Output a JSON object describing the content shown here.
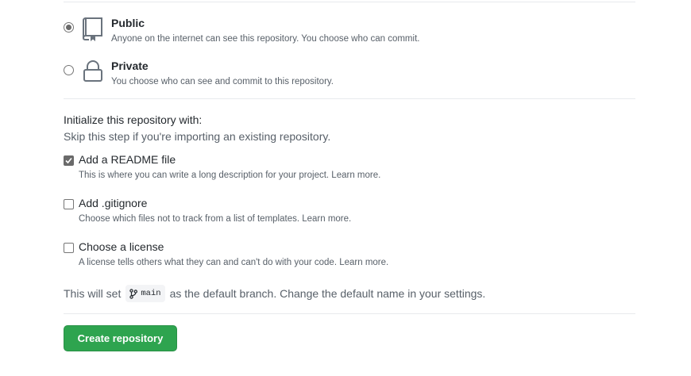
{
  "visibility": {
    "options": [
      {
        "title": "Public",
        "description": "Anyone on the internet can see this repository. You choose who can commit.",
        "icon": "repo-icon",
        "selected": true
      },
      {
        "title": "Private",
        "description": "You choose who can see and commit to this repository.",
        "icon": "lock-icon",
        "selected": false
      }
    ]
  },
  "initialize": {
    "title": "Initialize this repository with:",
    "subtitle": "Skip this step if you're importing an existing repository.",
    "options": [
      {
        "label": "Add a README file",
        "description": "This is where you can write a long description for your project. Learn more.",
        "checked": true
      },
      {
        "label": "Add .gitignore",
        "description": "Choose which files not to track from a list of templates. Learn more.",
        "checked": false
      },
      {
        "label": "Choose a license",
        "description": "A license tells others what they can and can't do with your code. Learn more.",
        "checked": false
      }
    ]
  },
  "branch": {
    "prefix": "This will set",
    "name": "main",
    "suffix": "as the default branch. Change the default name in your settings.",
    "icon": "git-branch-icon"
  },
  "actions": {
    "create_label": "Create repository",
    "create_color": "#2ea44f"
  }
}
